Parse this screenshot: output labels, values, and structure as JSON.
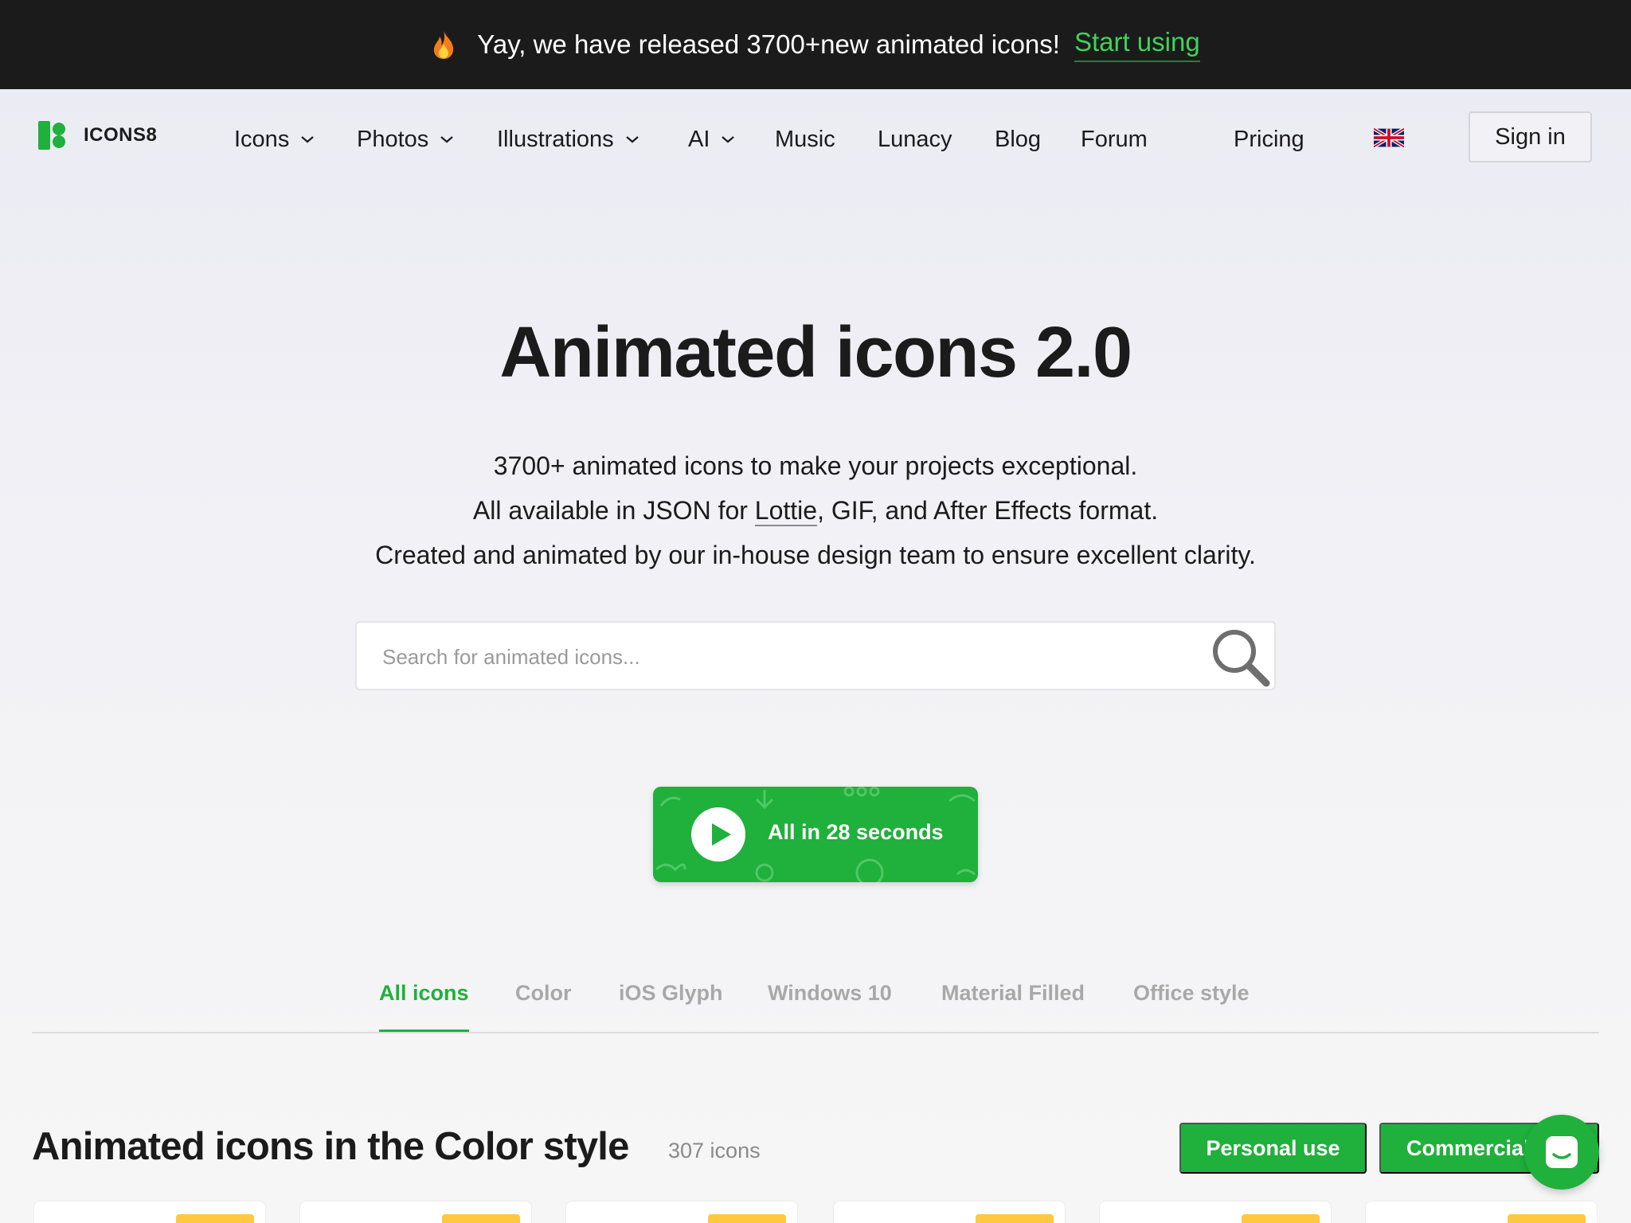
{
  "banner": {
    "icon": "fire-icon",
    "message": "Yay, we have released 3700+new animated icons!",
    "link": "Start using"
  },
  "header": {
    "logo_text": "ICONS8",
    "nav": [
      {
        "label": "Icons",
        "dropdown": true
      },
      {
        "label": "Photos",
        "dropdown": true
      },
      {
        "label": "Illustrations",
        "dropdown": true
      },
      {
        "label": "AI",
        "dropdown": true
      },
      {
        "label": "Music",
        "dropdown": false
      },
      {
        "label": "Lunacy",
        "dropdown": false
      },
      {
        "label": "Blog",
        "dropdown": false
      },
      {
        "label": "Forum",
        "dropdown": false
      },
      {
        "label": "Pricing",
        "dropdown": false
      }
    ],
    "language_icon": "uk-flag-icon",
    "sign_in": "Sign in"
  },
  "hero": {
    "title": "Animated icons 2.0",
    "line1": "3700+ animated icons to make your projects exceptional.",
    "line2_before": "All available in JSON for ",
    "line2_link": "Lottie",
    "line2_after": ", GIF, and After Effects format.",
    "line3": "Created and animated by our in-house design team to ensure excellent clarity.",
    "search_placeholder": "Search for animated icons...",
    "video_button": "All in 28 seconds"
  },
  "tabs": [
    {
      "label": "All icons",
      "active": true
    },
    {
      "label": "Color",
      "active": false
    },
    {
      "label": "iOS Glyph",
      "active": false
    },
    {
      "label": "Windows 10",
      "active": false
    },
    {
      "label": "Material Filled",
      "active": false
    },
    {
      "label": "Office style",
      "active": false
    }
  ],
  "section": {
    "title": "Animated icons in the Color style",
    "count": "307 icons",
    "personal_button": "Personal use",
    "commercial_button": "Commercial use"
  },
  "colors": {
    "accent": "#20b03c",
    "banner_bg": "#1b1b1b",
    "banner_link": "#3fd35a",
    "badge": "#ffc83d"
  }
}
